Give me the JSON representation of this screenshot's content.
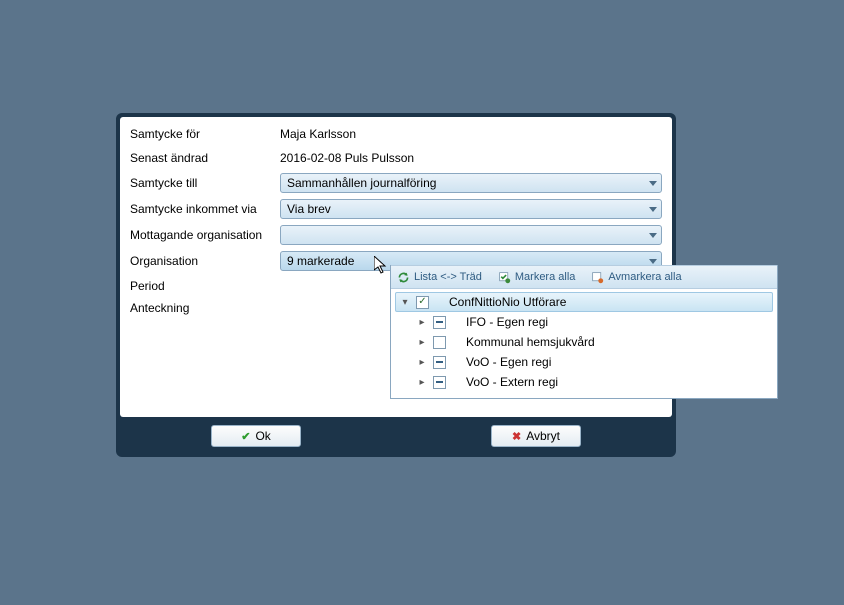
{
  "form": {
    "labels": {
      "samtyckeFor": "Samtycke för",
      "senastAndrad": "Senast ändrad",
      "samtyckeTill": "Samtycke till",
      "samtyckeInkommetVia": "Samtycke inkommet via",
      "mottagandeOrganisation": "Mottagande organisation",
      "organisation": "Organisation",
      "period": "Period",
      "anteckning": "Anteckning"
    },
    "values": {
      "samtyckeFor": "Maja Karlsson",
      "senastAndrad": "2016-02-08 Puls Pulsson",
      "samtyckeTill": "Sammanhållen journalföring",
      "samtyckeInkommetVia": "Via brev",
      "mottagandeOrganisation": "",
      "organisation": "9 markerade"
    }
  },
  "dropdown": {
    "toolbar": {
      "listaTrad": "Lista <-> Träd",
      "markeraAlla": "Markera alla",
      "avmarkeraAlla": "Avmarkera alla"
    },
    "tree": {
      "root": {
        "label": "ConfNittioNio Utförare",
        "state": "checked"
      },
      "children": [
        {
          "label": "IFO - Egen regi",
          "state": "partial"
        },
        {
          "label": "Kommunal hemsjukvård",
          "state": "empty"
        },
        {
          "label": "VoO - Egen regi",
          "state": "partial"
        },
        {
          "label": "VoO - Extern regi",
          "state": "partial"
        }
      ]
    }
  },
  "buttons": {
    "ok": "Ok",
    "cancel": "Avbryt"
  }
}
